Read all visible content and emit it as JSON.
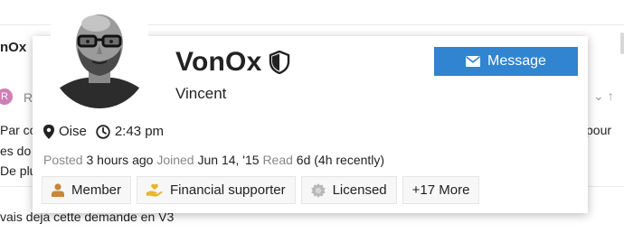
{
  "background": {
    "topic_title_fragment": "nOx",
    "author_initial": "R",
    "author_fragment": "R",
    "text_lines": [
      "Par co",
      "es do",
      "De plu"
    ],
    "right_fragment": "pour",
    "reply_fragment": "vais deja cette demande en V3"
  },
  "card": {
    "username": "VonOx",
    "full_name": "Vincent",
    "message_label": "Message",
    "location": "Oise",
    "local_time": "2:43 pm",
    "stats": {
      "posted_label": "Posted",
      "posted_value": "3 hours ago",
      "joined_label": "Joined",
      "joined_value": "Jun 14, '15",
      "read_label": "Read",
      "read_value": "6d (4h recently)"
    },
    "badges": [
      {
        "label": "Member",
        "icon": "member-icon"
      },
      {
        "label": "Financial supporter",
        "icon": "hand-heart-icon"
      },
      {
        "label": "Licensed",
        "icon": "certificate-icon"
      },
      {
        "label": "+17 More",
        "icon": ""
      }
    ]
  },
  "colors": {
    "accent": "#3184cf",
    "member_icon": "#c8863c",
    "supporter_icon": "#e8b530",
    "licensed_icon": "#b8b8b8",
    "muted_text": "#888888"
  }
}
